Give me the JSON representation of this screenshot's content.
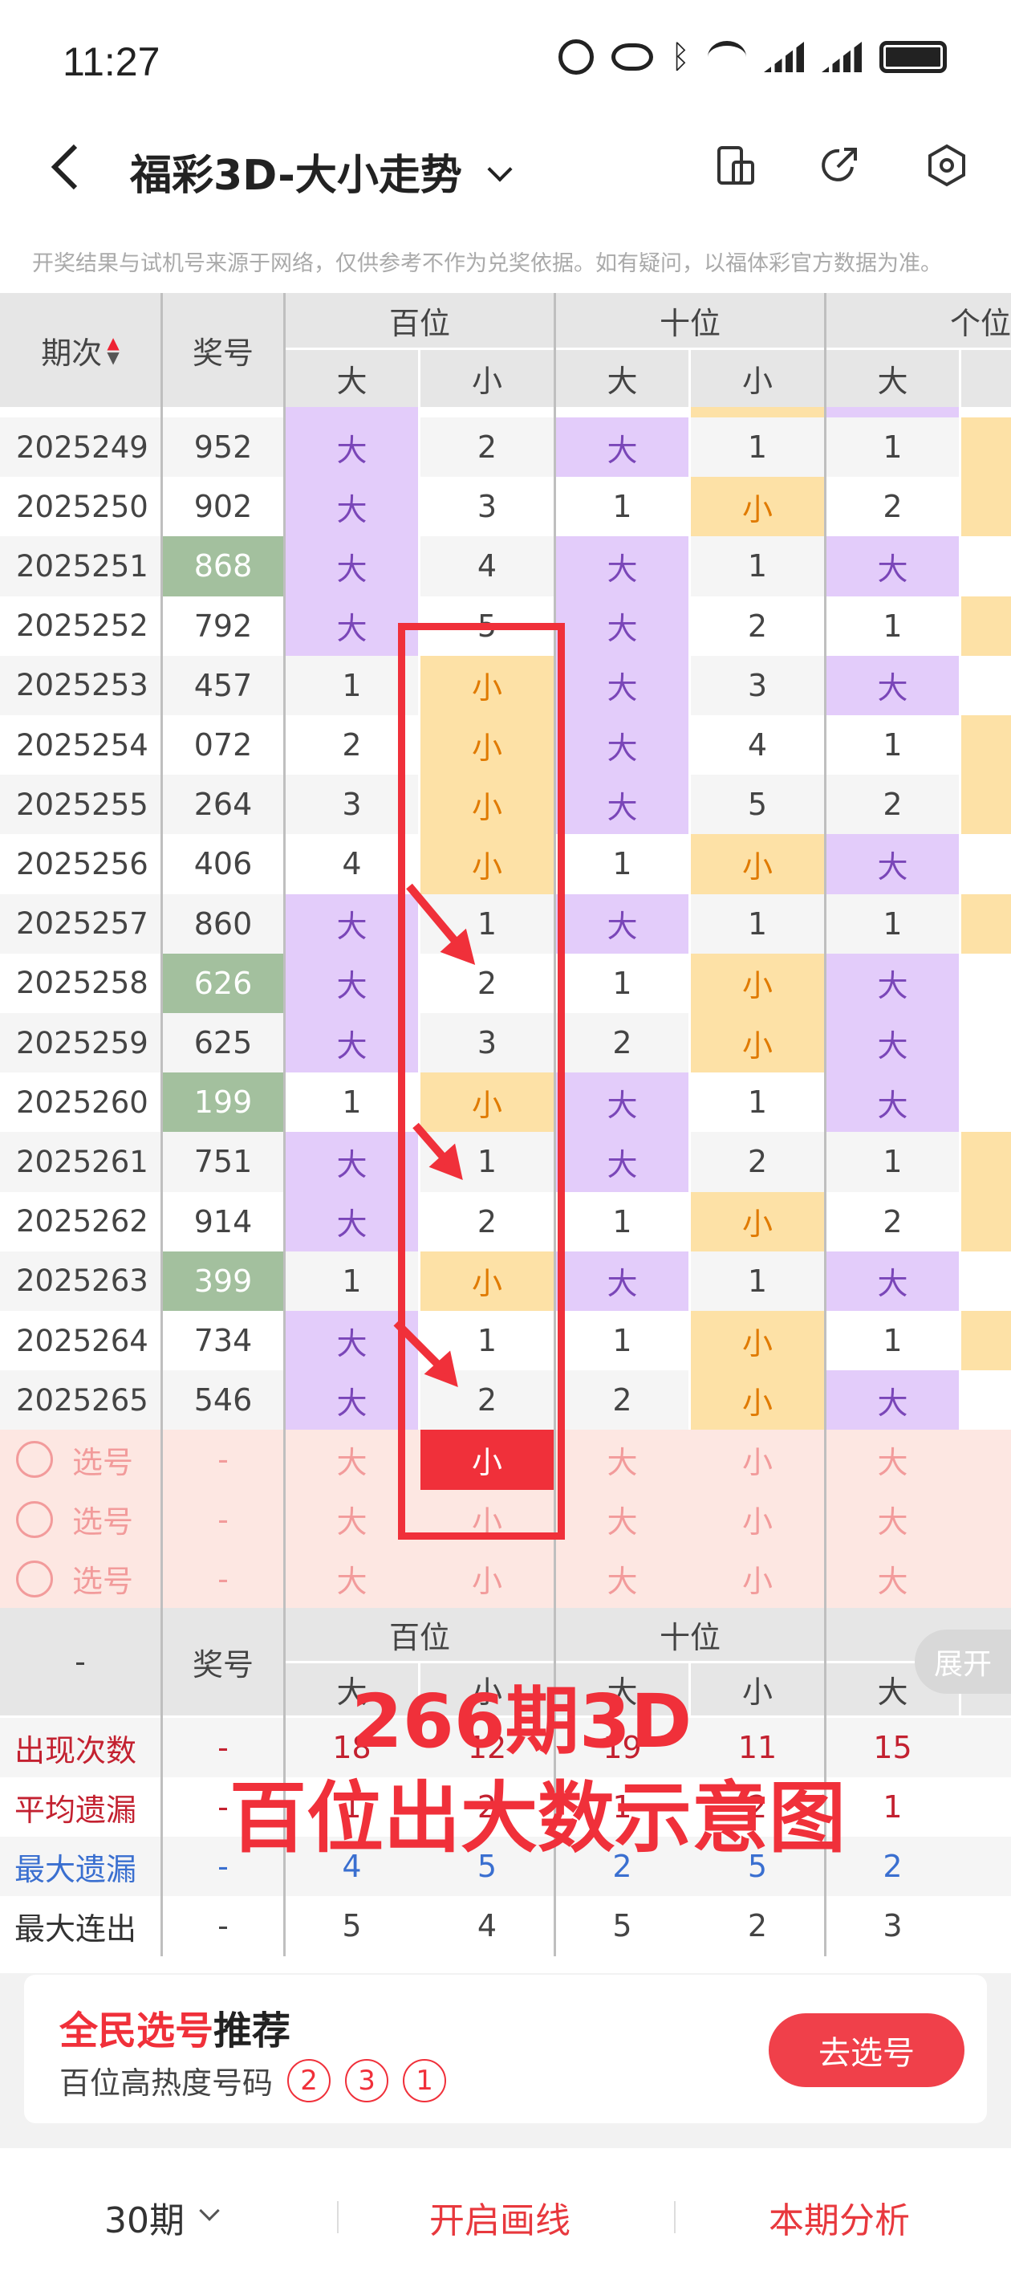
{
  "status": {
    "time": "11:27"
  },
  "header": {
    "title": "福彩3D-大小走势",
    "notice": "开奖结果与试机号来源于网络，仅供参考不作为兑奖依据。如有疑问，以福体彩官方数据为准。"
  },
  "table": {
    "col_period": "期次",
    "col_number": "奖号",
    "groups": [
      "百位",
      "十位",
      "个位"
    ],
    "sub": [
      "大",
      "小"
    ],
    "rows": [
      {
        "period": "2025249",
        "num": "952",
        "highlight": false,
        "cells": [
          "大",
          "2",
          "大",
          "1",
          "1"
        ]
      },
      {
        "period": "2025250",
        "num": "902",
        "highlight": false,
        "cells": [
          "大",
          "3",
          "1",
          "小",
          "2"
        ]
      },
      {
        "period": "2025251",
        "num": "868",
        "highlight": true,
        "cells": [
          "大",
          "4",
          "大",
          "1",
          "大"
        ]
      },
      {
        "period": "2025252",
        "num": "792",
        "highlight": false,
        "cells": [
          "大",
          "5",
          "大",
          "2",
          "1"
        ]
      },
      {
        "period": "2025253",
        "num": "457",
        "highlight": false,
        "cells": [
          "1",
          "小",
          "大",
          "3",
          "大"
        ]
      },
      {
        "period": "2025254",
        "num": "072",
        "highlight": false,
        "cells": [
          "2",
          "小",
          "大",
          "4",
          "1"
        ]
      },
      {
        "period": "2025255",
        "num": "264",
        "highlight": false,
        "cells": [
          "3",
          "小",
          "大",
          "5",
          "2"
        ]
      },
      {
        "period": "2025256",
        "num": "406",
        "highlight": false,
        "cells": [
          "4",
          "小",
          "1",
          "小",
          "大"
        ]
      },
      {
        "period": "2025257",
        "num": "860",
        "highlight": false,
        "cells": [
          "大",
          "1",
          "大",
          "1",
          "1"
        ]
      },
      {
        "period": "2025258",
        "num": "626",
        "highlight": true,
        "cells": [
          "大",
          "2",
          "1",
          "小",
          "大"
        ]
      },
      {
        "period": "2025259",
        "num": "625",
        "highlight": false,
        "cells": [
          "大",
          "3",
          "2",
          "小",
          "大"
        ]
      },
      {
        "period": "2025260",
        "num": "199",
        "highlight": true,
        "cells": [
          "1",
          "小",
          "大",
          "1",
          "大"
        ]
      },
      {
        "period": "2025261",
        "num": "751",
        "highlight": false,
        "cells": [
          "大",
          "1",
          "大",
          "2",
          "1"
        ]
      },
      {
        "period": "2025262",
        "num": "914",
        "highlight": false,
        "cells": [
          "大",
          "2",
          "1",
          "小",
          "2"
        ]
      },
      {
        "period": "2025263",
        "num": "399",
        "highlight": true,
        "cells": [
          "1",
          "小",
          "大",
          "1",
          "大"
        ]
      },
      {
        "period": "2025264",
        "num": "734",
        "highlight": false,
        "cells": [
          "大",
          "1",
          "1",
          "小",
          "1"
        ]
      },
      {
        "period": "2025265",
        "num": "546",
        "highlight": false,
        "cells": [
          "大",
          "2",
          "2",
          "小",
          "大"
        ]
      }
    ],
    "select_rows": [
      {
        "label": "选号",
        "num": "-",
        "cells": [
          "大",
          "小",
          "大",
          "小",
          "大"
        ]
      },
      {
        "label": "选号",
        "num": "-",
        "cells": [
          "大",
          "小",
          "大",
          "小",
          "大"
        ]
      },
      {
        "label": "选号",
        "num": "-",
        "cells": [
          "大",
          "小",
          "大",
          "小",
          "大"
        ]
      }
    ]
  },
  "stats": {
    "dash": "-",
    "col_number": "奖号",
    "expand": "展开",
    "rows": [
      {
        "label": "出现次数",
        "num": "-",
        "cells": [
          "18",
          "12",
          "19",
          "11",
          "15"
        ]
      },
      {
        "label": "平均遗漏",
        "num": "-",
        "cells": [
          "1",
          "2",
          "1",
          "2",
          "1"
        ]
      },
      {
        "label": "最大遗漏",
        "num": "-",
        "cells": [
          "4",
          "5",
          "2",
          "5",
          "2"
        ]
      },
      {
        "label": "最大连出",
        "num": "-",
        "cells": [
          "5",
          "4",
          "5",
          "2",
          "3"
        ]
      }
    ]
  },
  "overlay": {
    "line1": "266期3D",
    "line2": "百位出大数示意图"
  },
  "card": {
    "title_red": "全民选号",
    "title_black": "推荐",
    "subtitle": "百位高热度号码",
    "numbers": [
      "2",
      "3",
      "1"
    ],
    "button": "去选号"
  },
  "tabbar": {
    "periods": "30期",
    "draw": "开启画线",
    "analysis": "本期分析"
  }
}
